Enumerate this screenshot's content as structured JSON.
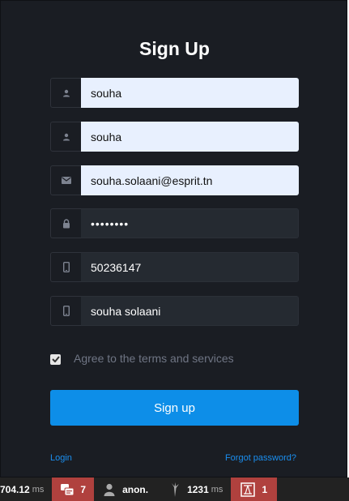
{
  "form": {
    "title": "Sign Up",
    "fields": [
      {
        "icon": "user-icon",
        "value": "souha",
        "type": "text"
      },
      {
        "icon": "user-icon",
        "value": "souha",
        "type": "text"
      },
      {
        "icon": "envelope-icon",
        "value": "souha.solaani@esprit.tn",
        "type": "email"
      },
      {
        "icon": "lock-icon",
        "value": "soolaani",
        "type": "password"
      },
      {
        "icon": "phone-icon",
        "value": "50236147",
        "type": "text"
      },
      {
        "icon": "phone-icon",
        "value": "souha solaani",
        "type": "text"
      }
    ],
    "agree_label": "Agree to the terms and services",
    "agree_checked": true,
    "submit_label": "Sign up",
    "login_link": "Login",
    "forgot_link": "Forgot password?"
  },
  "debug_toolbar": {
    "request_time": "704.12",
    "request_time_unit": "ms",
    "log_count": "7",
    "user": "anon.",
    "memory": "1231",
    "memory_unit": "ms",
    "errors": "1"
  },
  "colors": {
    "background": "#1a1d23",
    "input_filled": "#e8f0fe",
    "input_dark": "#252a31",
    "accent": "#0d8ee8",
    "link": "#1a8ff0",
    "toolbar": "#222222",
    "toolbar_alert": "#b0413e"
  }
}
